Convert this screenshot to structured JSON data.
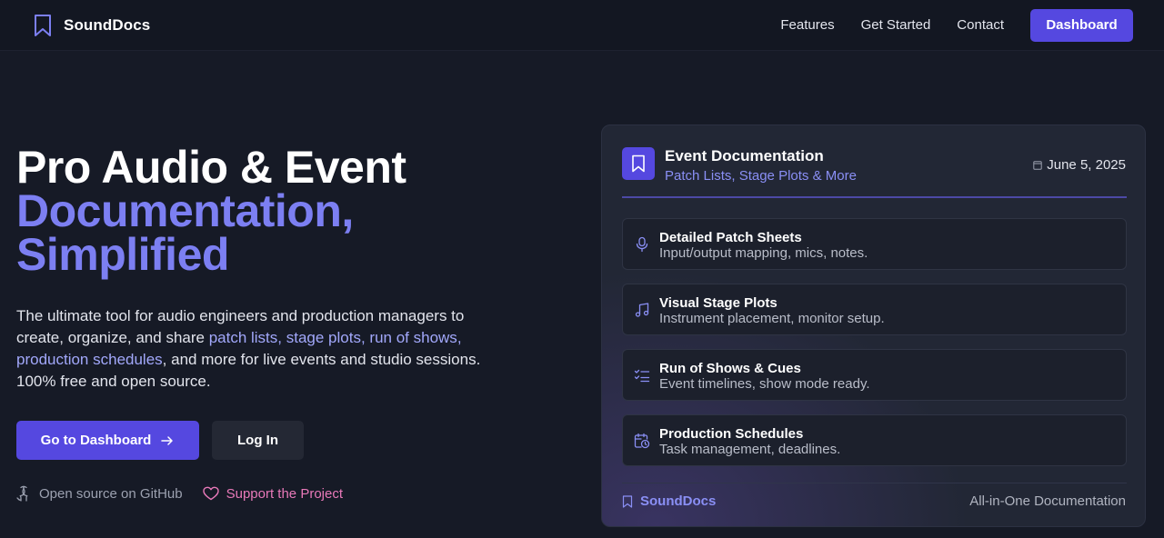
{
  "brand": {
    "name": "SoundDocs",
    "icon": "bookmark-icon",
    "accent": "#5548e0"
  },
  "nav": {
    "links": [
      "Features",
      "Get Started",
      "Contact"
    ],
    "dashboard_label": "Dashboard"
  },
  "hero": {
    "title_line1": "Pro Audio & Event",
    "title_line2": "Documentation,",
    "title_line3": "Simplified",
    "desc": {
      "part1": "The ultimate tool for audio engineers and production managers to create, organize, and share ",
      "hl1": "patch lists",
      "sep1": ", ",
      "hl2": "stage plots",
      "sep2": ", ",
      "hl3": "run of shows",
      "sep3": ", ",
      "hl4": "production schedules",
      "part2": ", and more for live events and studio sessions. 100% free and open source."
    },
    "primary_button": "Go to Dashboard",
    "secondary_button": "Log In",
    "github_link": "Open source on GitHub",
    "support_link": "Support the Project"
  },
  "card": {
    "title": "Event Documentation",
    "subtitle": "Patch Lists, Stage Plots & More",
    "date": "June 5, 2025",
    "features": [
      {
        "title": "Detailed Patch Sheets",
        "desc": "Input/output mapping, mics, notes.",
        "icon": "microphone-icon"
      },
      {
        "title": "Visual Stage Plots",
        "desc": "Instrument placement, monitor setup.",
        "icon": "music-note-icon"
      },
      {
        "title": "Run of Shows & Cues",
        "desc": "Event timelines, show mode ready.",
        "icon": "checklist-icon"
      },
      {
        "title": "Production Schedules",
        "desc": "Task management, deadlines.",
        "icon": "calendar-clock-icon"
      }
    ],
    "footer_brand": "SoundDocs",
    "footer_tagline": "All-in-One Documentation"
  }
}
